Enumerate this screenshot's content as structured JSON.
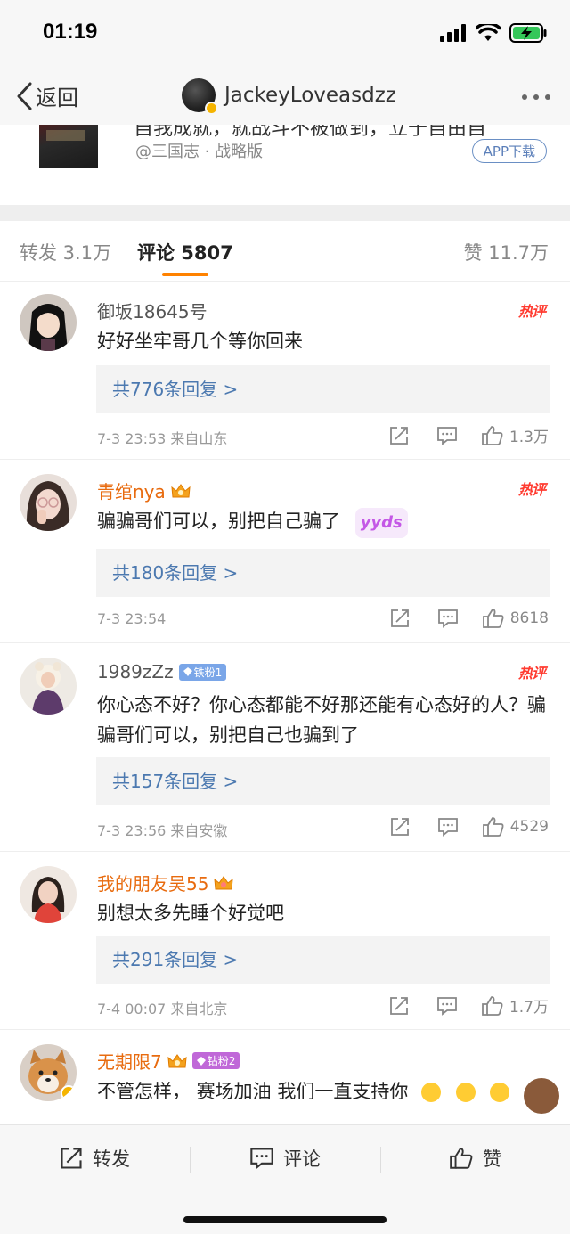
{
  "status": {
    "time": "01:19"
  },
  "nav": {
    "back_label": "返回",
    "title": "JackeyLoveasdzz"
  },
  "card": {
    "title_clip": "自我成就，就战斗不被做到，立于自由自",
    "source": "@三国志 · 战略版",
    "app_download": "APP下载"
  },
  "tabs": {
    "repost": "转发 3.1万",
    "comments": "评论 5807",
    "likes": "赞 11.7万"
  },
  "hot_label": "热评",
  "comments": [
    {
      "name": "御坂18645号",
      "text": "好好坐牢哥几个等你回来",
      "replies": "共776条回复 >",
      "meta": "7-3 23:53  来自山东",
      "likes": "1.3万"
    },
    {
      "name": "青绾nya",
      "text": "骗骗哥们可以，别把自己骗了",
      "sticker": "yyds",
      "replies": "共180条回复 >",
      "meta": "7-3 23:54",
      "likes": "8618"
    },
    {
      "name": "1989zZz",
      "badge": "铁粉1",
      "text": "你心态不好？你心态都能不好那还能有心态好的人？骗骗哥们可以，别把自己也骗到了",
      "replies": "共157条回复 >",
      "meta": "7-3 23:56  来自安徽",
      "likes": "4529"
    },
    {
      "name": "我的朋友吴55",
      "text": "别想太多先睡个好觉吧",
      "replies": "共291条回复 >",
      "meta": "7-4 00:07  来自北京",
      "likes": "1.7万"
    },
    {
      "name": "无期限7",
      "badge": "钻粉2",
      "text": "不管怎样， 赛场加油 我们一直支持你"
    }
  ],
  "toolbar": {
    "repost": "转发",
    "comment": "评论",
    "like": "赞"
  },
  "colors": {
    "accent": "#ff8200",
    "link": "#4c79b0",
    "vip_name": "#e86b0f",
    "hot": "#ff3b30"
  }
}
